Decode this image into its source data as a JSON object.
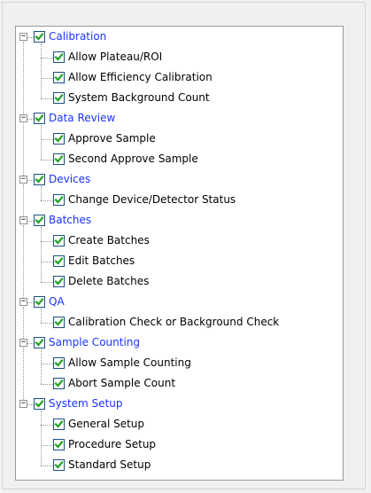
{
  "tree": {
    "groups": [
      {
        "label": "Calibration",
        "expander": "−",
        "checked": true,
        "children": [
          "Allow Plateau/ROI",
          "Allow Efficiency Calibration",
          "System Background Count"
        ]
      },
      {
        "label": "Data Review",
        "expander": "−",
        "checked": true,
        "children": [
          "Approve Sample",
          "Second Approve Sample"
        ]
      },
      {
        "label": "Devices",
        "expander": "−",
        "checked": true,
        "children": [
          "Change Device/Detector Status"
        ]
      },
      {
        "label": "Batches",
        "expander": "−",
        "checked": true,
        "children": [
          "Create Batches",
          "Edit Batches",
          "Delete Batches"
        ]
      },
      {
        "label": "QA",
        "expander": "−",
        "checked": true,
        "children": [
          "Calibration Check or Background Check"
        ]
      },
      {
        "label": "Sample Counting",
        "expander": "−",
        "checked": true,
        "children": [
          "Allow Sample Counting",
          "Abort Sample Count"
        ]
      },
      {
        "label": "System Setup",
        "expander": "−",
        "checked": true,
        "children": [
          "General Setup",
          "Procedure Setup",
          "Standard Setup"
        ]
      }
    ]
  },
  "colors": {
    "parent_label": "#1a33ff",
    "child_label": "#000000",
    "check": "#21a121",
    "checkbox_border": "#1c5180",
    "tree_background": "#ffffff",
    "window_background": "#f0f0f0"
  },
  "icons": {
    "expander": "minus-box-icon",
    "checkbox": "checkmark-icon"
  }
}
